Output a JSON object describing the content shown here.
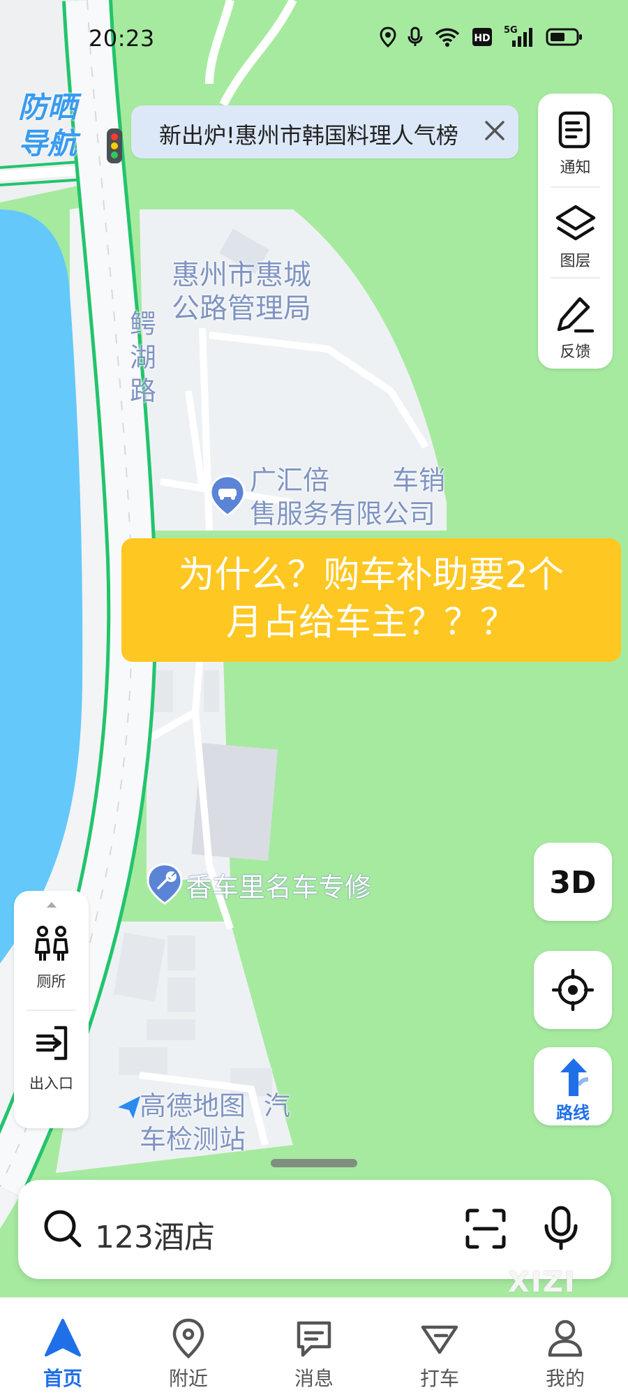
{
  "status_bar": {
    "time": "20:23",
    "network": "5G"
  },
  "brand": {
    "line1": "防晒",
    "line2": "导航"
  },
  "banner": {
    "text": "新出炉!惠州市韩国料理人气榜"
  },
  "map": {
    "road_name": [
      "鳄",
      "湖",
      "路"
    ],
    "pois": {
      "bureau": [
        "惠州市惠城",
        "公路管理局"
      ],
      "dealer": [
        "广汇倍",
        "车销",
        "售服务有限公司"
      ],
      "repair": "香车里名车专修",
      "inspection": [
        "高德地图",
        "汽",
        "车检测站"
      ]
    }
  },
  "right_panel": {
    "notice": "通知",
    "layers": "图层",
    "feedback": "反馈"
  },
  "left_panel": {
    "toilet": "厕所",
    "entrance": "出入口"
  },
  "fabs": {
    "three_d": "3D",
    "route": "路线"
  },
  "overlay": {
    "line1": "为什么？购车补助要2个",
    "line2": "月占给车主？？？"
  },
  "search": {
    "value": "123酒店"
  },
  "tabs": [
    {
      "label": "首页",
      "active": true
    },
    {
      "label": "附近",
      "active": false
    },
    {
      "label": "消息",
      "active": false
    },
    {
      "label": "打车",
      "active": false
    },
    {
      "label": "我的",
      "active": false
    }
  ],
  "watermark": "XIZI",
  "colors": {
    "accent": "#1f6fe8",
    "overlay": "#fec722",
    "water": "#64c8fa",
    "green_area": "#a6eaa0",
    "road_outline": "#22c46c"
  }
}
